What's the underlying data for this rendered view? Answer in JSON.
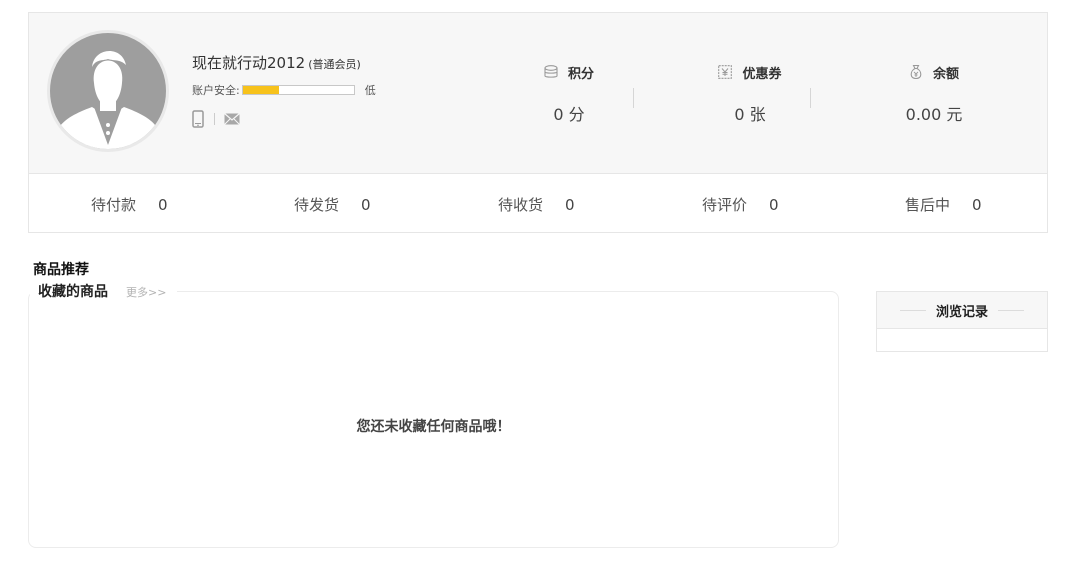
{
  "user": {
    "name": "现在就行动2012",
    "level": "(普通会员)",
    "security_label": "账户安全:",
    "security_level": "低",
    "security_progress_percent": 33
  },
  "icons": {
    "phone": "phone-icon",
    "email": "email-icon",
    "points": "coins-icon",
    "coupon": "yen-coupon-icon",
    "balance": "money-bag-icon"
  },
  "stats": [
    {
      "label": "积分",
      "value": "0 分"
    },
    {
      "label": "优惠券",
      "value": "0 张"
    },
    {
      "label": "余额",
      "value": "0.00 元"
    }
  ],
  "orders": [
    {
      "label": "待付款",
      "count": "0"
    },
    {
      "label": "待发货",
      "count": "0"
    },
    {
      "label": "待收货",
      "count": "0"
    },
    {
      "label": "待评价",
      "count": "0"
    },
    {
      "label": "售后中",
      "count": "0"
    }
  ],
  "recommend": {
    "title": "商品推荐",
    "favorites_title": "收藏的商品",
    "more_link": "更多>>",
    "empty_text": "您还未收藏任何商品哦！"
  },
  "history": {
    "title": "浏览记录"
  },
  "colors": {
    "security_fill": "#f7c21b",
    "header_bg": "#f7f7f7",
    "border": "#e6e6e6"
  }
}
